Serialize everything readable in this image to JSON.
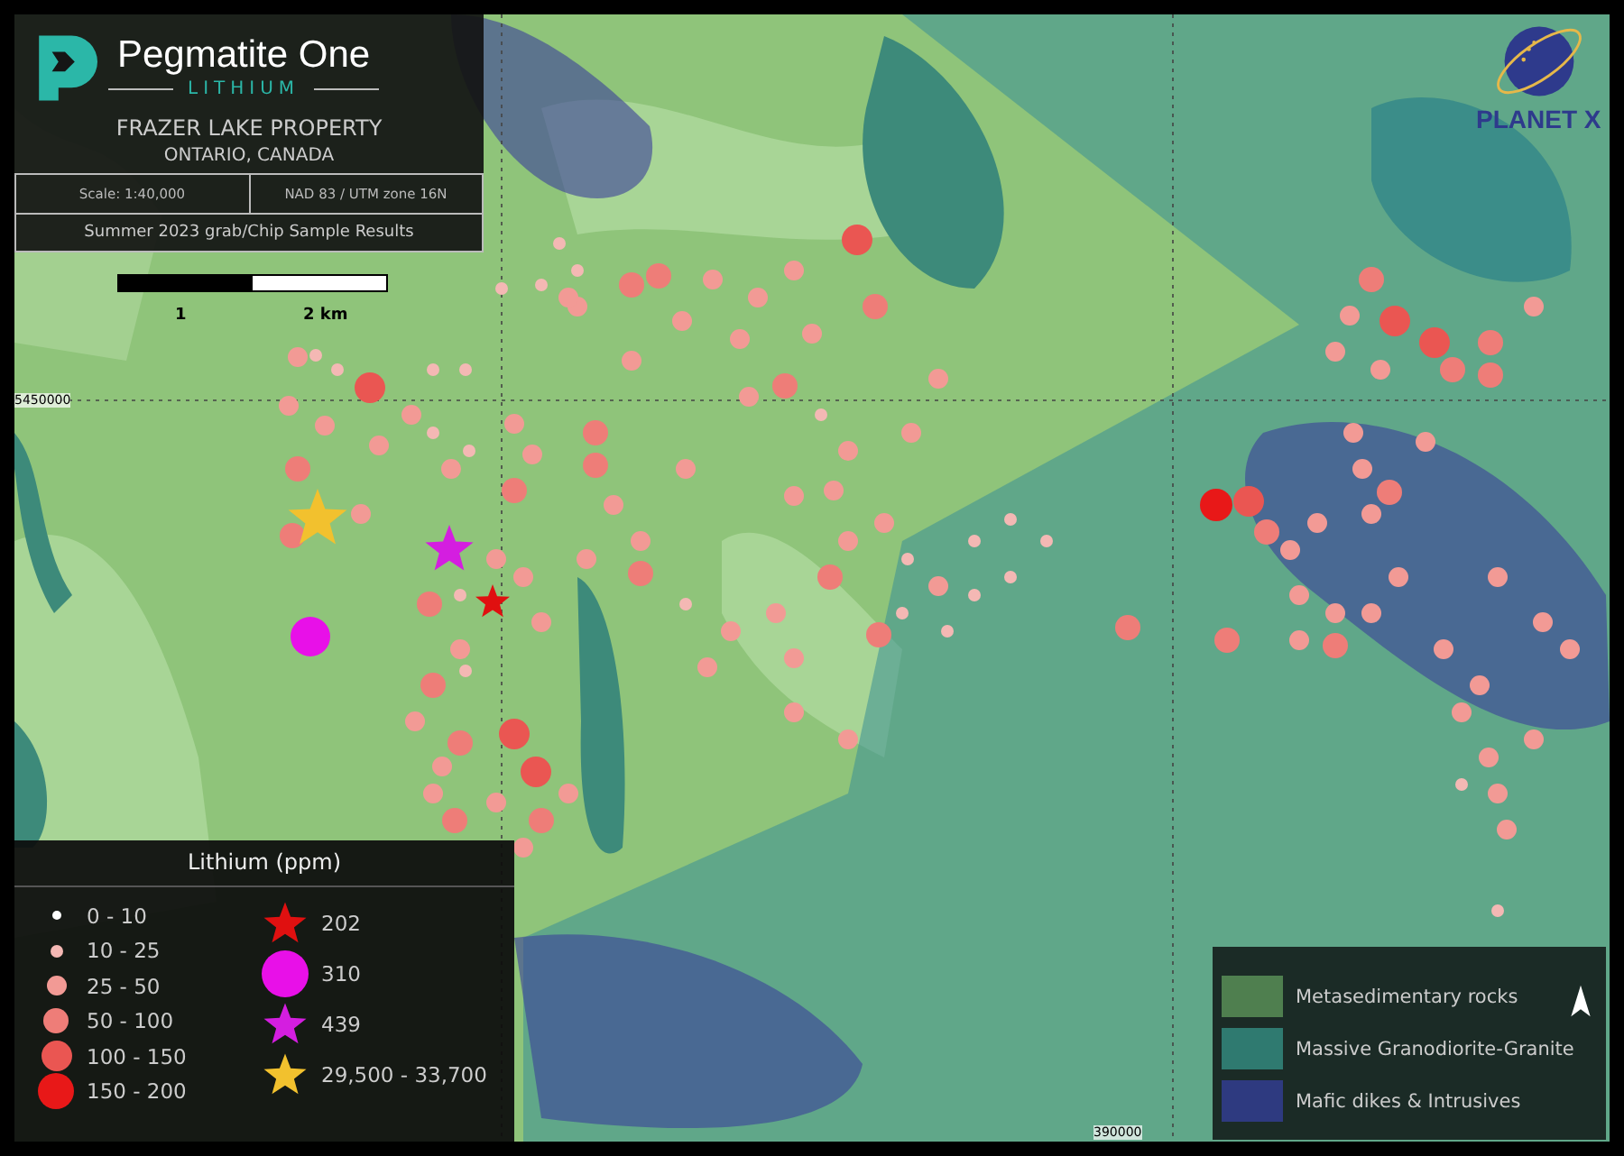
{
  "header": {
    "company": "Pegmatite One",
    "company_sub": "LITHIUM",
    "property": "FRAZER LAKE PROPERTY",
    "location": "ONTARIO, CANADA",
    "scale": "Scale: 1:40,000",
    "projection": "NAD 83 / UTM zone 16N",
    "subtitle": "Summer 2023 grab/Chip Sample Results"
  },
  "scale_bar": {
    "labels": [
      "1",
      "2 km"
    ]
  },
  "grid_labels": {
    "northing": "5450000",
    "easting": "390000"
  },
  "partner_logo": {
    "name": "PLANET X"
  },
  "lithium_legend": {
    "title": "Lithium (ppm)",
    "items": [
      {
        "kind": "dot",
        "label": "0 - 10",
        "color": "#ffffff"
      },
      {
        "kind": "dot",
        "label": "10 - 25",
        "color": "#f4b8b4"
      },
      {
        "kind": "dot",
        "label": "25 - 50",
        "color": "#f29a95"
      },
      {
        "kind": "dot",
        "label": "50 - 100",
        "color": "#ee7d78"
      },
      {
        "kind": "dot",
        "label": "100 - 150",
        "color": "#ea5652"
      },
      {
        "kind": "dot",
        "label": "150 - 200",
        "color": "#e81818"
      },
      {
        "kind": "star",
        "label": "202",
        "color": "#e01010"
      },
      {
        "kind": "circle",
        "label": "310",
        "color": "#e810e8"
      },
      {
        "kind": "star",
        "label": "439",
        "color": "#d41ee0"
      },
      {
        "kind": "star",
        "label": "29,500 - 33,700",
        "color": "#f2c12e"
      }
    ]
  },
  "geology_legend": {
    "items": [
      {
        "label": "Metasedimentary rocks",
        "color": "#4f7f4f"
      },
      {
        "label": "Massive Granodiorite-Granite",
        "color": "#2f7a70"
      },
      {
        "label": "Mafic dikes & Intrusives",
        "color": "#2e3a80"
      }
    ]
  }
}
